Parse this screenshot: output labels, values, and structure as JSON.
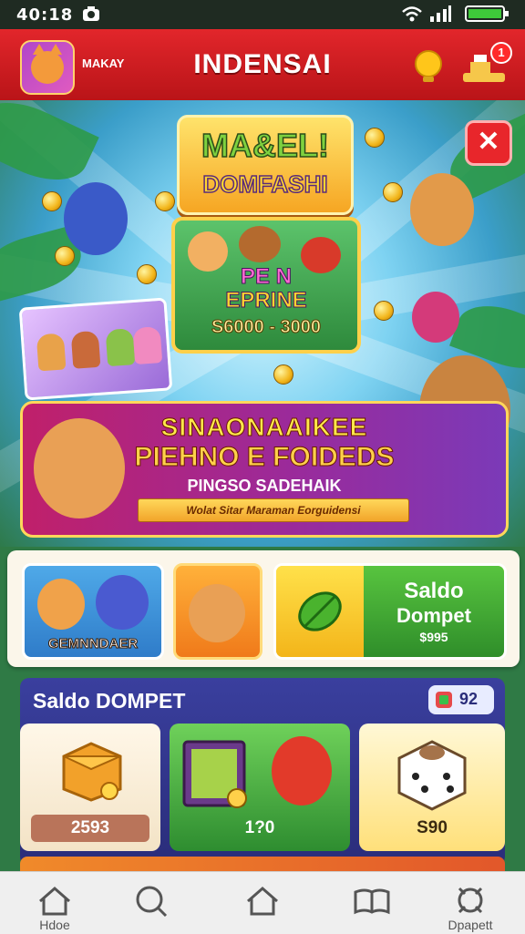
{
  "status_bar": {
    "time": "40:18"
  },
  "header": {
    "title": "INDENSAI",
    "username": "MAKAY",
    "notification_count": "1"
  },
  "banner": {
    "logo_line1": "MA&EL!",
    "logo_line2": "DOMFASHI",
    "prize_line1": "PE N",
    "prize_line2": "EPRINE",
    "prize_amount": "S6000 - 3000",
    "promo_line1": "SINAONAAIKEE",
    "promo_line2": "PIEHNO E FOIDEDS",
    "promo_line3": "PINGSO SADEHAIK",
    "ribbon_text": "Wolat Sitar Maraman Eorguidensi",
    "close_symbol": "✕"
  },
  "quick_tiles": {
    "tile1_caption": "GEMNNDAER",
    "wallet_tile_line1": "Saldo",
    "wallet_tile_line2": "Dompet",
    "wallet_tile_amount": "$995"
  },
  "wallet_section": {
    "title": "Saldo DOMPET",
    "badge_value": "92",
    "cards": [
      {
        "value": "2593",
        "icon": "treasure-box-icon"
      },
      {
        "value": "1?0",
        "icon": "mystery-game-icon"
      },
      {
        "value": "S90",
        "icon": "dice-icon"
      }
    ]
  },
  "nav": [
    {
      "label": "Hdoe",
      "icon": "home-icon"
    },
    {
      "label": "",
      "icon": "search-icon"
    },
    {
      "label": "",
      "icon": "house-icon"
    },
    {
      "label": "",
      "icon": "book-icon"
    },
    {
      "label": "Dpapett",
      "icon": "wallet-icon"
    }
  ],
  "colors": {
    "header_red": "#e2262b",
    "wallet_blue": "#2a2d7a",
    "accent_green": "#2f8e2a",
    "gold": "#ffd04a"
  }
}
